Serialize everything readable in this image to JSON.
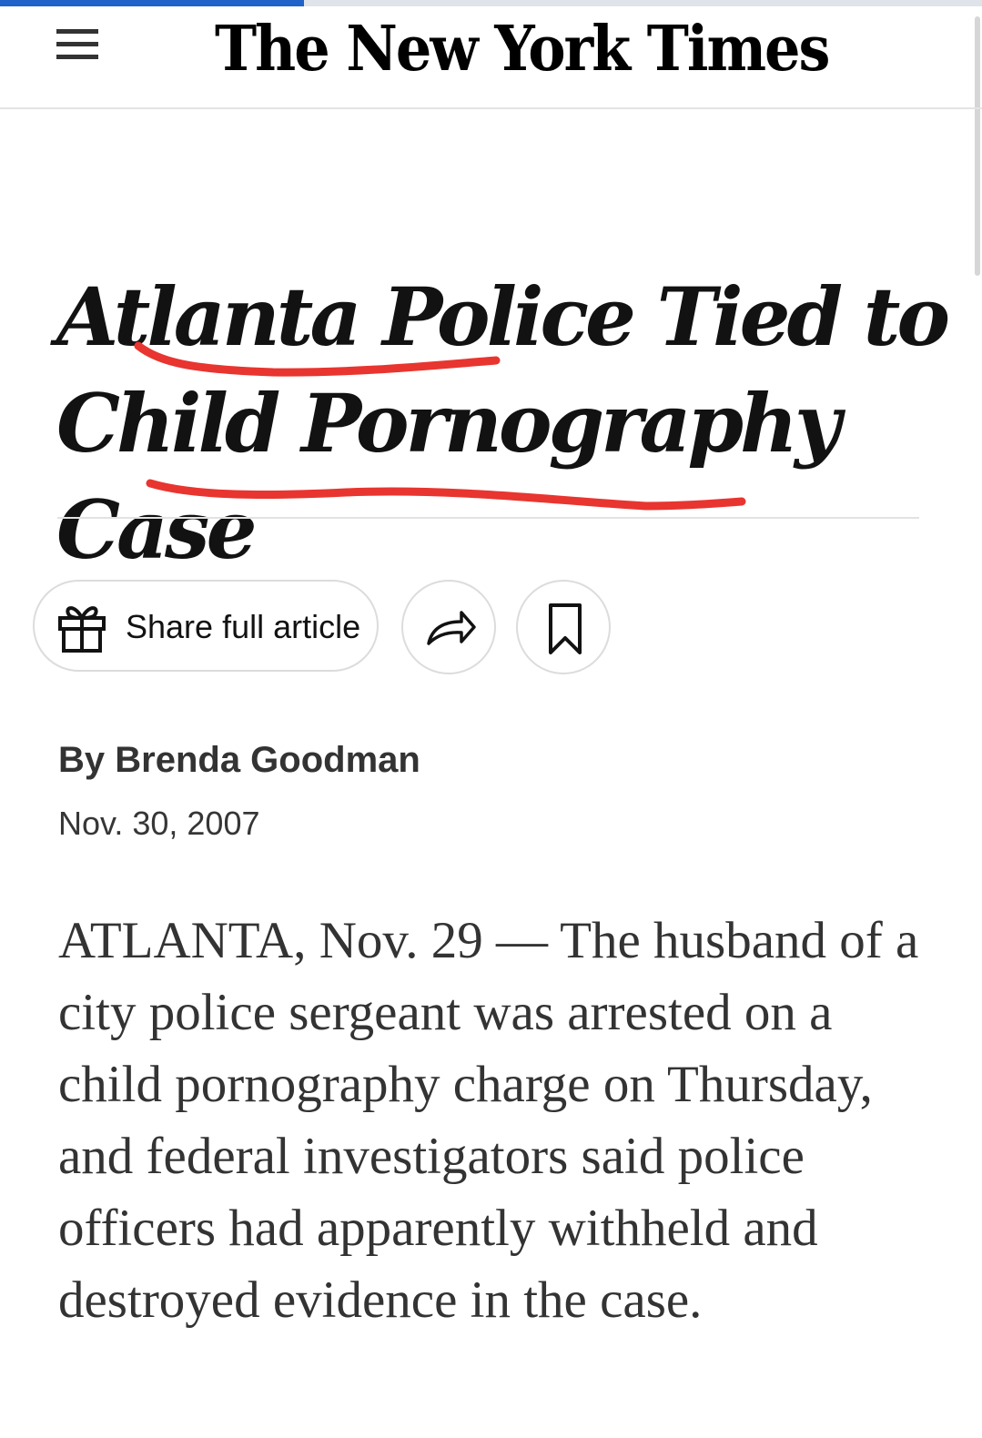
{
  "page_load": {
    "progress": 0.31
  },
  "masthead": {
    "menu_icon": "hamburger-menu-icon",
    "logo_text": "The New York Times"
  },
  "article": {
    "headline": "Atlanta Police Tied to Child Pornography Case",
    "share_button_label": "Share full article",
    "share_icon": "gift-icon",
    "forward_icon": "share-arrow-icon",
    "bookmark_icon": "bookmark-icon",
    "byline": "By Brenda Goodman",
    "date": "Nov. 30, 2007",
    "body": "ATLANTA, Nov. 29 — The husband of a city police sergeant was arrested on a child pornography charge on Thursday, and federal investigators said police officers had apparently withheld and destroyed evidence in the case."
  },
  "colors": {
    "annotation_underline": "#e8352f",
    "load_bar": "#1f62c9",
    "text": "#121212",
    "border": "#dcdcdc"
  }
}
